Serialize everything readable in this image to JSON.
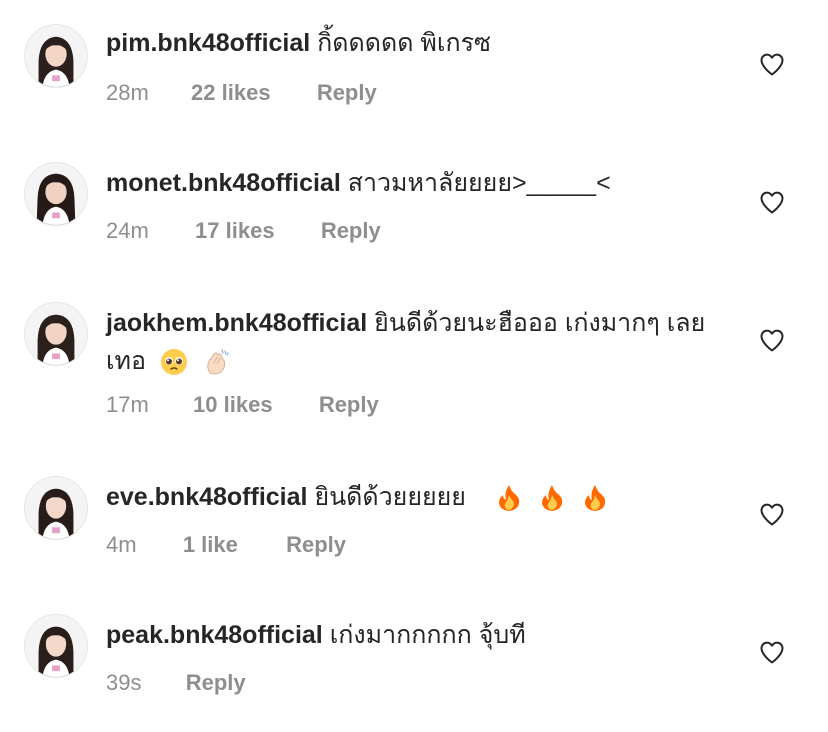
{
  "comments": [
    {
      "username": "pim.bnk48official",
      "text": "กิ้ดดดดด พิเกรซ",
      "time": "28m",
      "likes": "22 likes",
      "reply": "Reply",
      "emojis": []
    },
    {
      "username": "monet.bnk48official",
      "text": "สาวมหาลัยยยย>_____<",
      "time": "24m",
      "likes": "17 likes",
      "reply": "Reply",
      "emojis": []
    },
    {
      "username": "jaokhem.bnk48official",
      "text": "ยินดีด้วยนะฮือออ เก่งมากๆ เลยเทอ",
      "time": "17m",
      "likes": "10 likes",
      "reply": "Reply",
      "emojis": [
        "pleading-face",
        "clapping-hands"
      ]
    },
    {
      "username": "eve.bnk48official",
      "text": "ยินดีด้วยยยยย",
      "time": "4m",
      "likes": "1 like",
      "reply": "Reply",
      "emojis": [
        "fire",
        "fire",
        "fire"
      ]
    },
    {
      "username": "peak.bnk48official",
      "text": "เก่งมากกกกก จุ้บที",
      "time": "39s",
      "likes": "",
      "reply": "Reply",
      "emojis": []
    }
  ],
  "icons": {
    "like": "heart-outline-icon",
    "avatar": "profile-photo"
  },
  "colors": {
    "text": "#262626",
    "meta": "#8e8e8e",
    "fire": "#ff6a00"
  }
}
